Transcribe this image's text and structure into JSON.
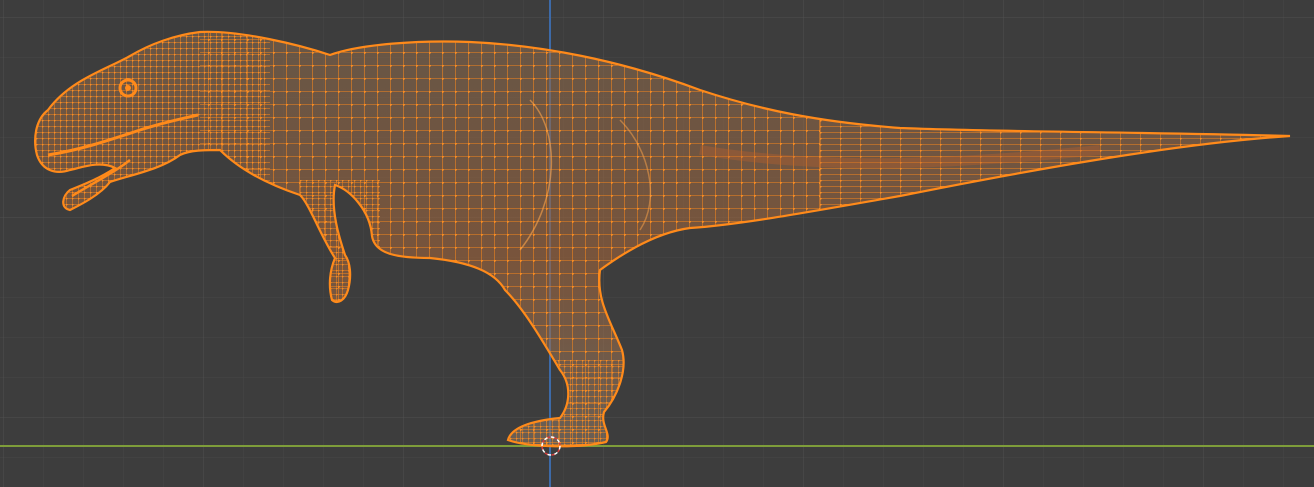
{
  "viewport": {
    "view": "orthographic-side",
    "mode": "edit-mode",
    "background_color": "#3d3d3d",
    "grid_minor_color": "#444444",
    "grid_major_color": "#4e4e4e",
    "x_axis_color": "#7e9d3a",
    "z_axis_color": "#3d6aa8",
    "selection_color": "#ff8a1a",
    "object": {
      "name": "dinosaur-mesh",
      "shading": "wireframe-xray",
      "selected": true
    },
    "icons": {
      "cursor": "3d-cursor-icon"
    }
  }
}
